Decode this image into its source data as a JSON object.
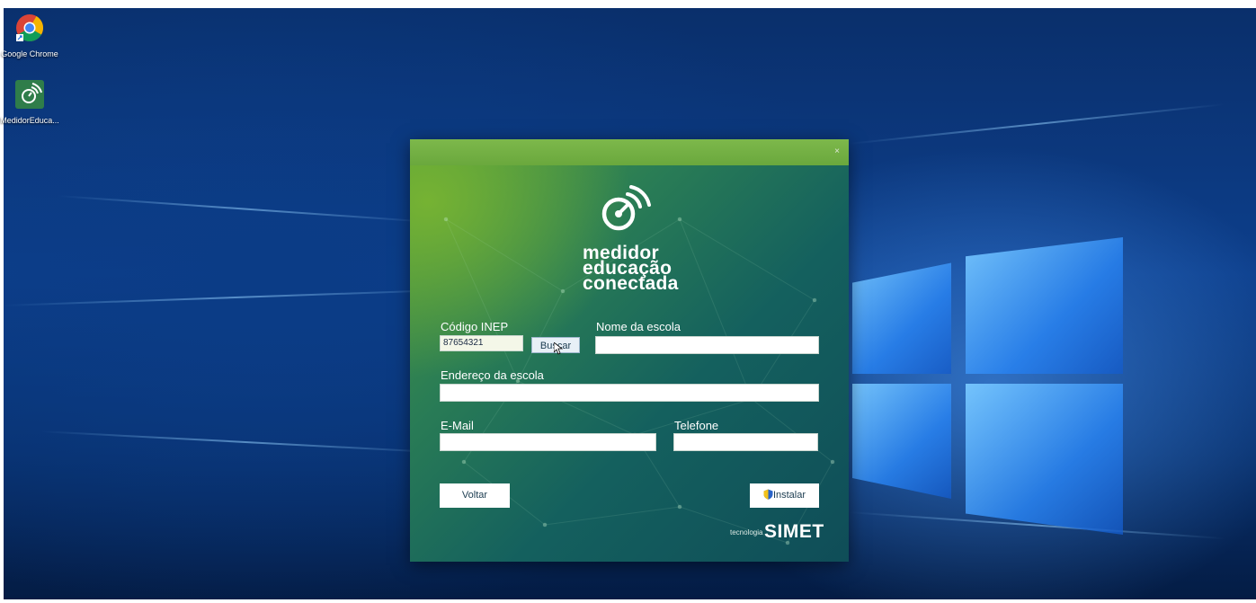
{
  "desktop": {
    "icons": [
      {
        "label": "Google Chrome",
        "icon": "chrome-icon"
      },
      {
        "label": "MedidorEduca...",
        "icon": "speedometer-app-icon"
      }
    ]
  },
  "dialog": {
    "close_glyph": "×",
    "logo": {
      "icon": "speedometer-signal-icon",
      "line1": "medidor",
      "line2": "educação",
      "line3": "conectada"
    },
    "form": {
      "inep_label": "Código INEP",
      "inep_value": "87654321",
      "search_button": "Buscar",
      "school_name_label": "Nome da escola",
      "school_name_value": "",
      "address_label": "Endereço da escola",
      "address_value": "",
      "email_label": "E-Mail",
      "email_value": "",
      "phone_label": "Telefone",
      "phone_value": ""
    },
    "back_button": "Voltar",
    "install_button": "Instalar",
    "install_icon": "shield-icon",
    "footer": {
      "tech_label": "tecnologia",
      "brand": "SIMET"
    }
  },
  "colors": {
    "titlebar": "#7db84b",
    "dialog_bg_start": "#4f9a3d",
    "dialog_bg_end": "#0f4d58",
    "wallpaper": "#0a2f6b"
  }
}
